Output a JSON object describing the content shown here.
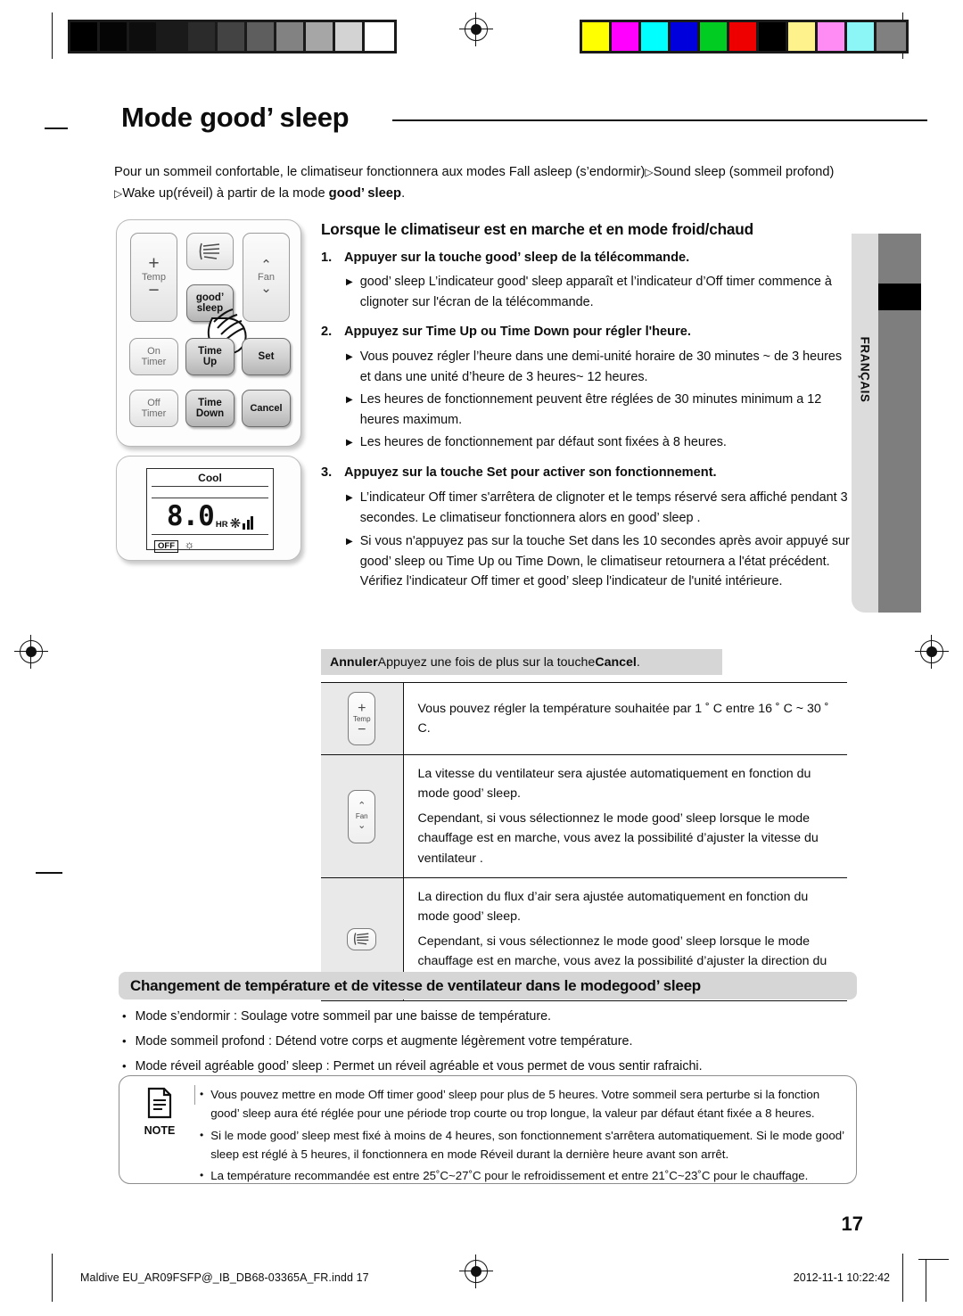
{
  "title": {
    "prefix": "Mode ",
    "brand": "good’ sleep"
  },
  "intro": {
    "line1": "Pour un sommeil confortable, le climatiseur fonctionnera aux modes Fall asleep (s’endormir)",
    "tri1": "▷",
    "line1b": "Sound sleep (sommeil profond)",
    "tri2": "▷",
    "line2": "Wake up(réveil) à partir de la mode ",
    "brand": "good’ sleep",
    "line2b": "."
  },
  "remote": {
    "temp_label": "Temp",
    "plus": "+",
    "minus": "−",
    "fan_label": "Fan",
    "chev_up": "⌃",
    "chev_down": "⌄",
    "good_sleep_line1": "good’",
    "good_sleep_line2": "sleep",
    "on_timer_l1": "On",
    "on_timer_l2": "Timer",
    "off_timer_l1": "Off",
    "off_timer_l2": "Timer",
    "time_up_l1": "Time",
    "time_up_l2": "Up",
    "time_down_l1": "Time",
    "time_down_l2": "Down",
    "set": "Set",
    "cancel": "Cancel"
  },
  "lcd": {
    "mode": "Cool",
    "value": "8.0",
    "unit": "HR",
    "off_tag": "OFF"
  },
  "section": {
    "heading": "Lorsque le climatiseur est en marche et en mode froid/chaud",
    "steps": [
      {
        "num": "1.",
        "text_before": "Appuyer sur la touche ",
        "brand": "good’ sleep",
        "text_after": " de la télécommande.",
        "bullets": [
          "good’ sleep L’indicateur good' sleep apparaît et  l’indicateur d’Off timer commence à clignoter sur l'écran de la télécommande."
        ]
      },
      {
        "num": "2.",
        "text_before": "Appuyez sur Time Up ou Time Down pour régler l'heure.",
        "bullets": [
          "Vous pouvez régler l’heure dans une demi-unité horaire de 30 minutes ~ de 3 heures et dans une unité d’heure de 3 heures~ 12 heures.",
          "Les heures de fonctionnement peuvent être réglées de 30 minutes minimum a 12 heures maximum.",
          "Les heures de fonctionnement par défaut sont fixées à 8 heures."
        ]
      },
      {
        "num": "3.",
        "text_before": "Appuyez sur la touche Set pour activer son fonctionnement.",
        "bullets": [
          "L’indicateur Off timer s'arrêtera de clignoter et le temps réservé sera affiché pendant 3 secondes. Le climatiseur fonctionnera alors en good’ sleep .",
          "Si vous n'appuyez pas sur la touche Set dans les 10 secondes après avoir appuyé sur good’ sleep ou Time Up ou Time Down, le climatiseur retournera a l'état précédent. Vérifiez l'indicateur Off timer et  good’ sleep l'indicateur de l'unité intérieure."
        ]
      }
    ],
    "bullet_arrow": "▶"
  },
  "annuler": {
    "label": "Annuler",
    "text_before": "  Appuyez une fois de plus sur la touche ",
    "bold": "Cancel",
    "text_after": "."
  },
  "table": {
    "rows": [
      {
        "icon": "temp-button-icon",
        "icon_label": "Temp",
        "paragraphs": [
          "Vous pouvez régler la température souhaitée par 1 ˚ C entre 16 ˚ C ~ 30 ˚ C."
        ]
      },
      {
        "icon": "fan-button-icon",
        "icon_label": "Fan",
        "paragraphs": [
          "La vitesse du ventilateur sera ajustée automatiquement en fonction du mode good’ sleep.",
          "Cependant, si vous sélectionnez le mode good’ sleep lorsque le mode chauffage est en marche, vous avez la possibilité d’ajuster la vitesse du ventilateur ."
        ]
      },
      {
        "icon": "airflow-button-icon",
        "icon_label": "",
        "paragraphs": [
          "La direction du flux d’air sera ajustée automatiquement en fonction du mode good’ sleep.",
          "Cependant, si vous sélectionnez le mode good’ sleep lorsque le mode chauffage est en marche, vous avez la possibilité d’ajuster la direction du flux d’air ."
        ]
      }
    ]
  },
  "gray_heading": {
    "text": "Changement de température et de vitesse de ventilateur dans le mode ",
    "brand": "good’ sleep"
  },
  "mode_bullets": [
    "Mode s’endormir : Soulage votre sommeil par une baisse de température.",
    "Mode sommeil profond : Détend votre corps et augmente légèrement votre température.",
    "Mode réveil agréable good’ sleep : Permet un réveil agréable et vous permet de vous sentir rafraichi."
  ],
  "note": {
    "label": "NOTE",
    "bullets": [
      "Vous pouvez mettre en mode Off timer good’ sleep pour plus de 5 heures. Votre sommeil sera perturbe si la fonction good’ sleep aura été réglée pour une période trop courte ou trop longue, la valeur par défaut étant fixée a 8 heures.",
      "Si le mode good’ sleep mest fixé à moins de 4 heures, son fonctionnement s'arrêtera automatiquement. Si le mode good’ sleep est réglé à 5 heures, il fonctionnera en mode Réveil durant la dernière heure avant son arrêt.",
      "La température recommandée est entre 25˚C~27˚C pour le refroidissement et entre 21˚C~23˚C pour le chauffage."
    ]
  },
  "sidetab": {
    "language": "FRANÇAIS"
  },
  "page_number": "17",
  "footer": {
    "left": "Maldive EU_AR09FSFP@_IB_DB68-03365A_FR.indd   17",
    "right": "2012-11-1   10:22:42"
  },
  "calibration": {
    "gray": [
      "#000000",
      "#050505",
      "#0d0d0d",
      "#1a1a1a",
      "#2b2b2b",
      "#434343",
      "#5e5e5e",
      "#828282",
      "#a6a6a6",
      "#d3d3d3",
      "#ffffff"
    ],
    "color": [
      "#ffff00",
      "#ff00ff",
      "#00ffff",
      "#0000dd",
      "#00cc22",
      "#ee0000",
      "#000000",
      "#fdf28c",
      "#ff8cf5",
      "#8cf5f5",
      "#808080"
    ]
  }
}
